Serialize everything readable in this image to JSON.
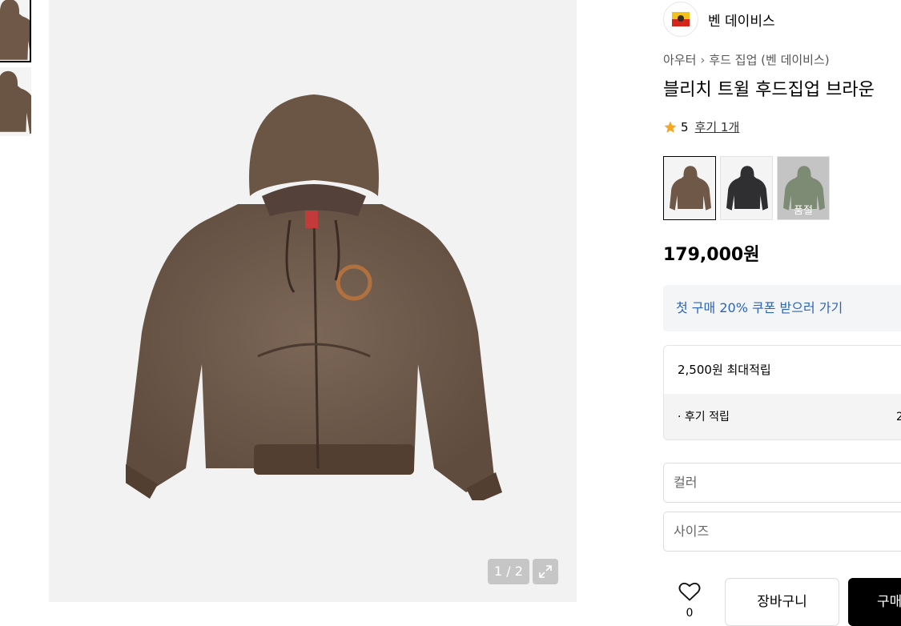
{
  "brand": {
    "name": "벤 데이비스",
    "logo": "ben-davis-gorilla-logo"
  },
  "breadcrumb": [
    "아우터",
    "후드 집업 (벤 데이비스)"
  ],
  "product": {
    "title": "블리치 트윌 후드집업 브라운",
    "rating": "5",
    "reviews_label": "후기 1개",
    "price": "179,000원"
  },
  "gallery": {
    "counter": "1 / 2",
    "thumbnail_count": 2
  },
  "swatches": [
    {
      "color": "brown",
      "selected": true,
      "sold_out": false,
      "label": ""
    },
    {
      "color": "black",
      "selected": false,
      "sold_out": false,
      "label": ""
    },
    {
      "color": "olive",
      "selected": false,
      "sold_out": true,
      "label": "품절"
    }
  ],
  "coupon": {
    "label": "첫 구매 20% 쿠폰 받으러 가기"
  },
  "points": {
    "title": "2,500원 최대적립",
    "row_label": "· 후기 적립",
    "row_value": "2"
  },
  "options": {
    "color_placeholder": "컬러",
    "size_placeholder": "사이즈"
  },
  "actions": {
    "like_count": "0",
    "cart_label": "장바구니",
    "buy_label": "구매"
  },
  "colors": {
    "coupon_text": "#2b64b8",
    "star": "#f5a623",
    "jacket_brown": "#6e5a4b"
  }
}
